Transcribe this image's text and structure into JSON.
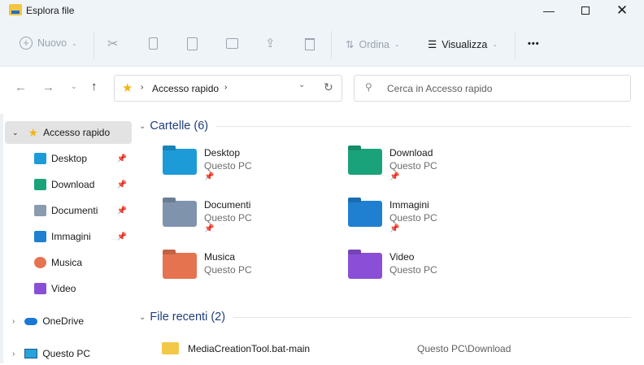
{
  "window": {
    "title": "Esplora file"
  },
  "toolbar": {
    "new_label": "Nuovo",
    "sort_label": "Ordina",
    "view_label": "Visualizza",
    "more_label": "•••"
  },
  "address": {
    "path": [
      "Accesso rapido"
    ]
  },
  "search": {
    "placeholder": "Cerca in Accesso rapido"
  },
  "sidebar": {
    "quick_access": "Accesso rapido",
    "items": [
      {
        "label": "Desktop",
        "pinned": true
      },
      {
        "label": "Download",
        "pinned": true
      },
      {
        "label": "Documenti",
        "pinned": true
      },
      {
        "label": "Immagini",
        "pinned": true
      },
      {
        "label": "Musica",
        "pinned": false
      },
      {
        "label": "Video",
        "pinned": false
      }
    ],
    "onedrive": "OneDrive",
    "this_pc": "Questo PC"
  },
  "folders_section": {
    "title": "Cartelle (6)",
    "items": [
      {
        "name": "Desktop",
        "location": "Questo PC",
        "color": "#1d9bd8"
      },
      {
        "name": "Download",
        "location": "Questo PC",
        "color": "#1aa37a"
      },
      {
        "name": "Documenti",
        "location": "Questo PC",
        "color": "#7f93ad"
      },
      {
        "name": "Immagini",
        "location": "Questo PC",
        "color": "#1f7fd1"
      },
      {
        "name": "Musica",
        "location": "Questo PC",
        "color": "#e5734f"
      },
      {
        "name": "Video",
        "location": "Questo PC",
        "color": "#8a4fd6"
      }
    ]
  },
  "recent_section": {
    "title": "File recenti (2)",
    "items": [
      {
        "name": "MediaCreationTool.bat-main",
        "location": "Questo PC\\Download"
      }
    ]
  }
}
